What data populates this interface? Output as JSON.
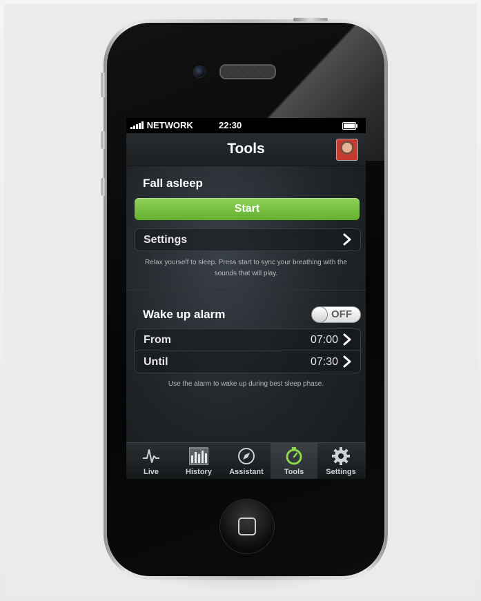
{
  "status_bar": {
    "carrier": "NETWORK",
    "time": "22:30"
  },
  "nav": {
    "title": "Tools"
  },
  "fall_asleep": {
    "title": "Fall asleep",
    "start_label": "Start",
    "settings_label": "Settings",
    "note": "Relax yourself to sleep. Press start to sync your breathing with the sounds that will play."
  },
  "wake_up": {
    "title": "Wake up alarm",
    "toggle_state": "OFF",
    "rows": [
      {
        "label": "From",
        "value": "07:00"
      },
      {
        "label": "Until",
        "value": "07:30"
      }
    ],
    "note": "Use the alarm to wake up during best sleep phase."
  },
  "tabs": [
    {
      "label": "Live",
      "icon": "pulse-icon",
      "active": false
    },
    {
      "label": "History",
      "icon": "bar-chart-icon",
      "active": false
    },
    {
      "label": "Assistant",
      "icon": "compass-icon",
      "active": false
    },
    {
      "label": "Tools",
      "icon": "stopwatch-icon",
      "active": true
    },
    {
      "label": "Settings",
      "icon": "gear-icon",
      "active": false
    }
  ],
  "colors": {
    "accent_green": "#7cc146",
    "active_tab_icon": "#8ed84a",
    "screen_bg": "#1f2428"
  }
}
